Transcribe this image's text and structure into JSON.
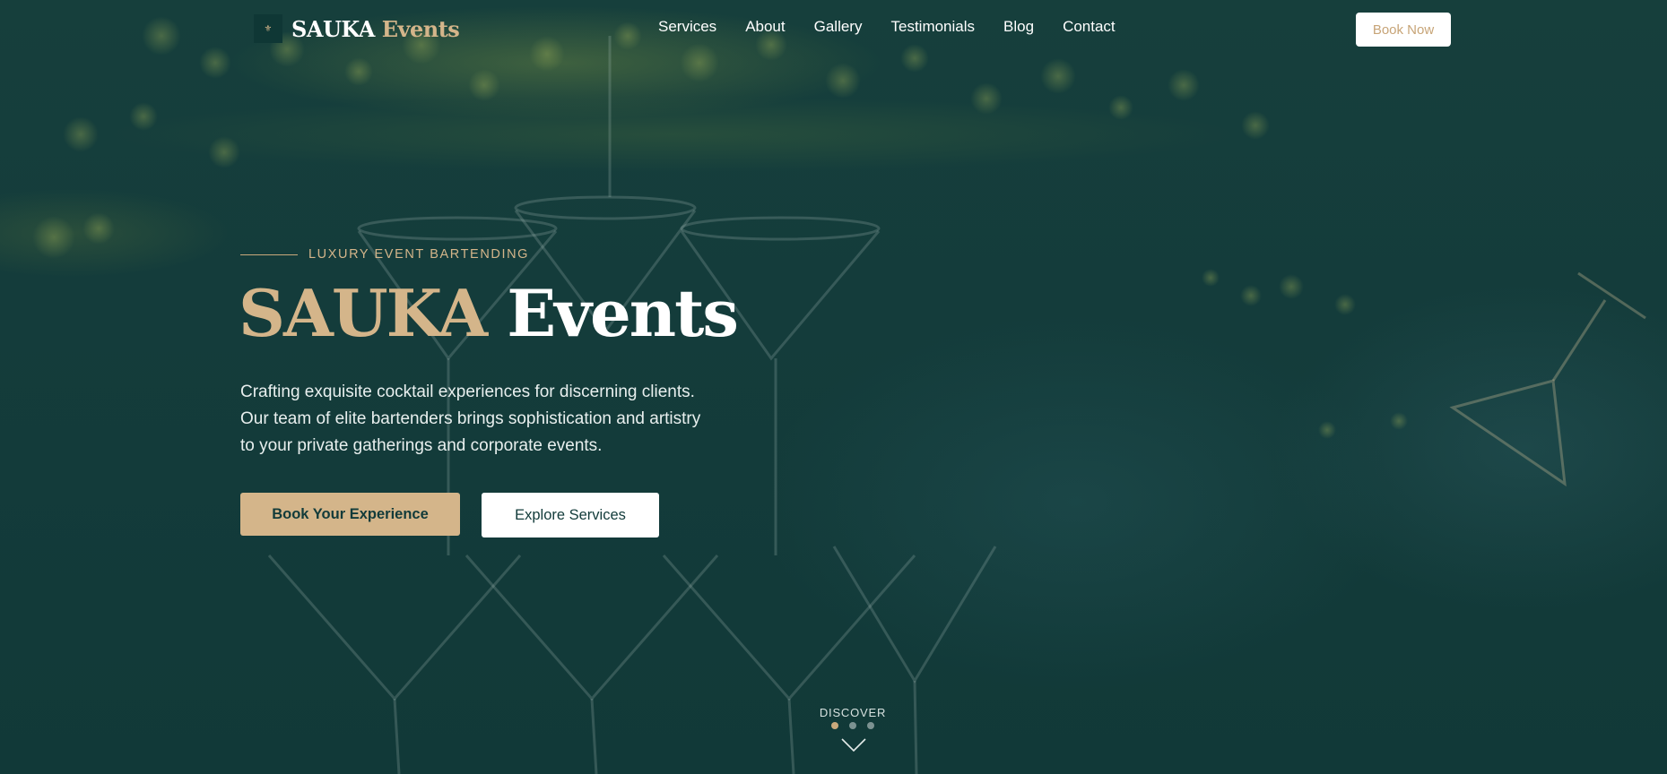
{
  "brand": {
    "logo_mark": "⚜",
    "name_main": "SAUKA",
    "name_accent": "Events"
  },
  "nav": {
    "items": [
      {
        "label": "Services"
      },
      {
        "label": "About"
      },
      {
        "label": "Gallery"
      },
      {
        "label": "Testimonials"
      },
      {
        "label": "Blog"
      },
      {
        "label": "Contact"
      }
    ],
    "cta_label": "Book Now"
  },
  "hero": {
    "eyebrow": "LUXURY EVENT BARTENDING",
    "headline_accent": "SAUKA",
    "headline_main": "Events",
    "description_lines": [
      "Crafting exquisite cocktail experiences for discerning clients.",
      "Our team of elite bartenders brings sophistication and artistry",
      "to your private gatherings and corporate events."
    ],
    "primary_button": "Book Your Experience",
    "secondary_button": "Explore Services"
  },
  "discover": {
    "label": "DISCOVER",
    "active_dot": 0,
    "dot_count": 3
  },
  "colors": {
    "background": "#123b3a",
    "gold": "#d4b58a",
    "white": "#ffffff"
  }
}
